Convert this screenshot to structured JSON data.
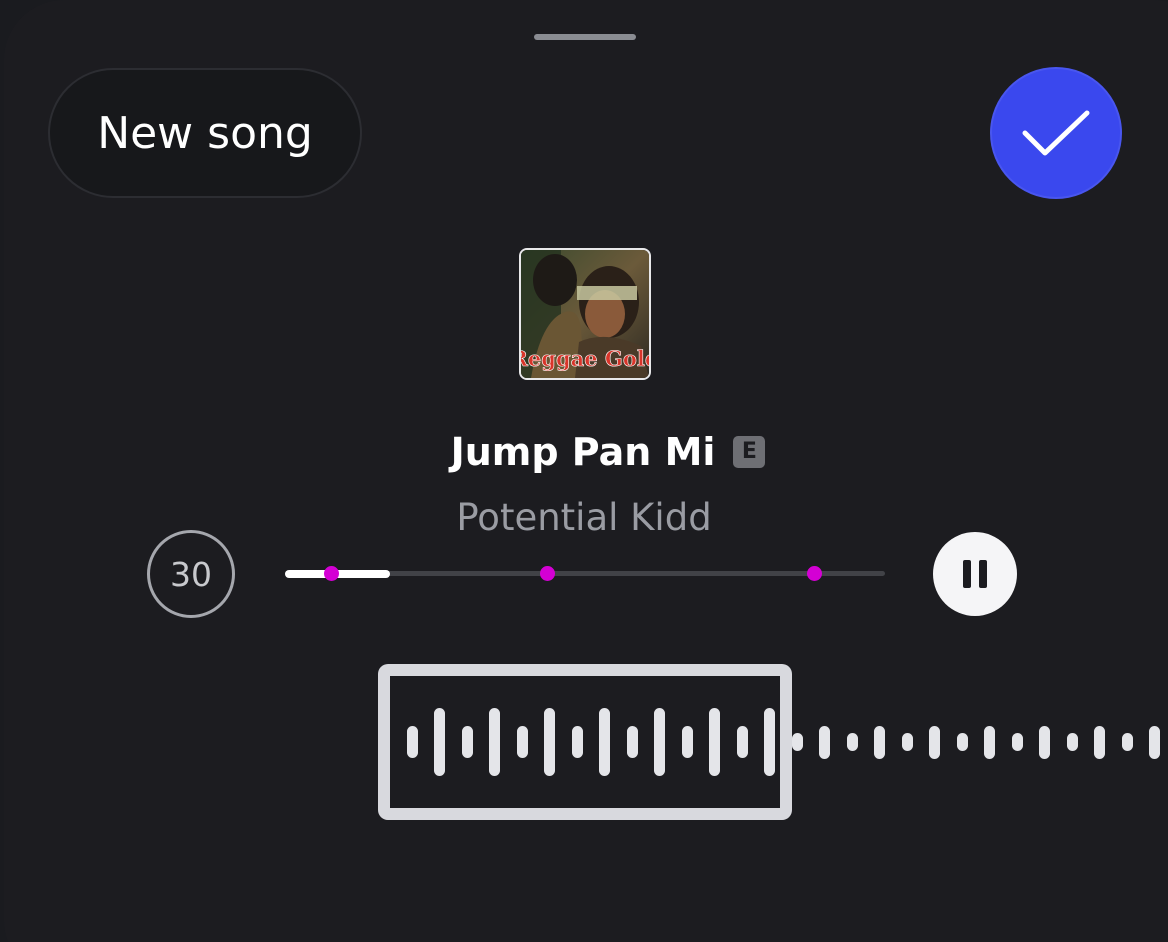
{
  "header": {
    "new_song_label": "New song",
    "confirm_icon": "checkmark-icon"
  },
  "track": {
    "title": "Jump Pan Mi",
    "explicit_badge": "E",
    "artist": "Potential Kidd",
    "artwork_text": "Reggae Gold"
  },
  "player": {
    "skip_seconds": "30",
    "progress": 0.175,
    "markers": [
      0.077,
      0.438,
      0.883
    ],
    "pause_icon": "pause-icon"
  },
  "waveform": {
    "selected_bars": [
      0.45,
      0.95,
      0.45,
      0.95,
      0.45,
      0.95,
      0.45,
      0.95,
      0.45,
      0.95,
      0.45,
      0.95,
      0.45,
      0.95
    ],
    "unselected_bars": [
      0.35,
      0.65,
      0.35,
      0.65,
      0.35,
      0.65,
      0.35,
      0.65,
      0.35,
      0.65,
      0.35,
      0.65,
      0.35,
      0.65
    ]
  },
  "colors": {
    "accent": "#3a48ee",
    "marker": "#d400d4",
    "background": "#1c1c20"
  }
}
